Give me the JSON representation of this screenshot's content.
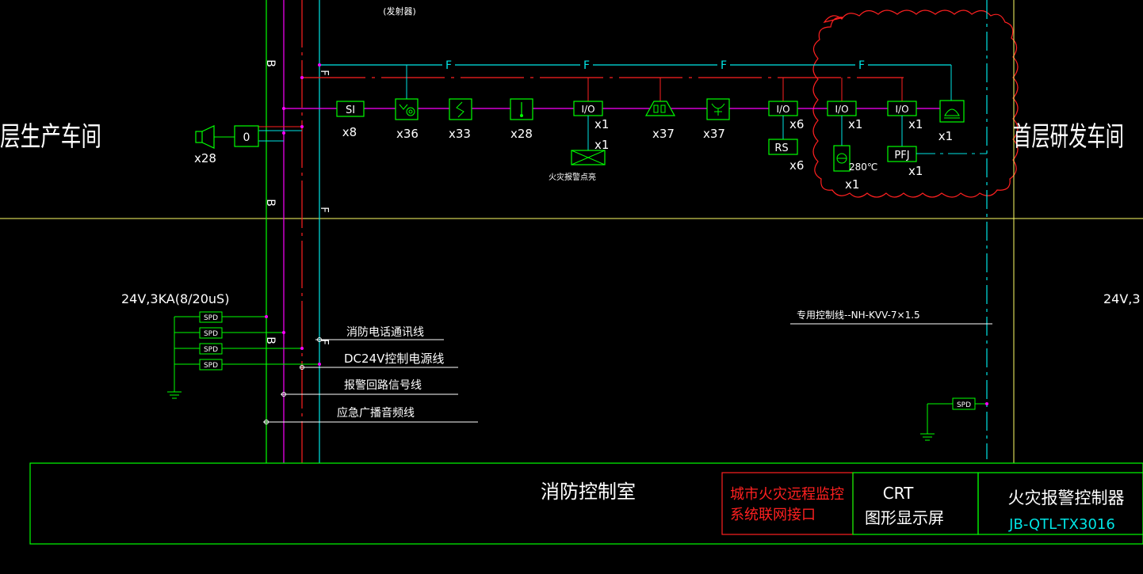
{
  "colors": {
    "background": "#000000",
    "green": "#00ff00",
    "cyan": "#00e5e5",
    "magenta": "#ff00ff",
    "red": "#ff2020",
    "yellow": "#ffff66",
    "white": "#ffffff",
    "cloud_red": "#ff2020"
  },
  "zones": {
    "left_title": "层生产车间",
    "right_title": "首层研发车间",
    "control_room": "消防控制室"
  },
  "top_partial_label": "(发射器)",
  "bus_labels": {
    "fire_line": "F",
    "broadcast_line": "B"
  },
  "devices": {
    "smoke_label": "SI",
    "smoke_count": "x8",
    "heat_smoke_count": "x36",
    "linear_count": "x33",
    "hydrant_count": "x28",
    "io1_label": "I/O",
    "io1_count": "x1",
    "damper_count": "x1",
    "damper_caption": "火灾报警点亮",
    "alarm_count": "x37",
    "manual_count": "x37",
    "io2_label": "I/O",
    "io2_count": "x6",
    "rs_label": "RS",
    "rs_count": "x6",
    "io3_label": "I/O",
    "io3_count": "x1",
    "valve_temp": "280℃",
    "valve_count": "x1",
    "io4_label": "I/O",
    "io4_count": "x1",
    "pfj_label": "PFJ",
    "pfj_count": "x1",
    "phone_count": "x1",
    "speaker_count": "x28",
    "speaker_module": "0"
  },
  "spd": {
    "rating": "24V,3KA(8/20uS)",
    "rating_right": "24V,3",
    "label": "SPD"
  },
  "legend": {
    "phone_line": "消防电话通讯线",
    "power_line": "DC24V控制电源线",
    "alarm_line": "报警回路信号线",
    "broadcast_line": "应急广播音频线"
  },
  "dedicated_line": "专用控制线--NH-KVV-7×1.5",
  "control_box": {
    "network_interface_line1": "城市火灾远程监控",
    "network_interface_line2": "系统联网接口",
    "crt_line1": "CRT",
    "crt_line2": "图形显示屏",
    "controller_name": "火灾报警控制器",
    "controller_model": "JB-QTL-TX3016"
  }
}
